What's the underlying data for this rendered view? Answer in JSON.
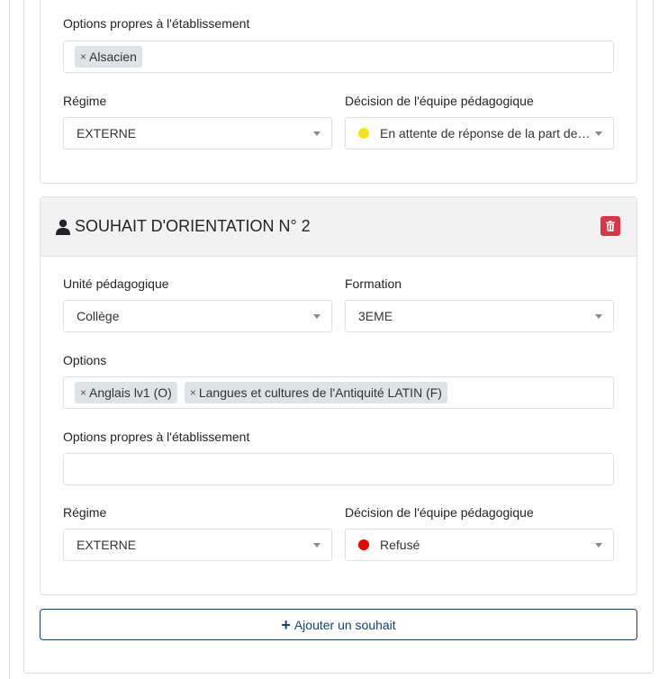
{
  "card1": {
    "options_propres_label": "Options propres à l'établissement",
    "options_propres_tags": [
      "Alsacien"
    ],
    "regime_label": "Régime",
    "regime_value": "EXTERNE",
    "decision_label": "Décision de l'équipe pédagogique",
    "decision_value": "En attente de réponse de la part de l...",
    "decision_color": "#f5e50f"
  },
  "card2": {
    "title": "SOUHAIT D'ORIENTATION N° 2",
    "unite_label": "Unité pédagogique",
    "unite_value": "Collège",
    "formation_label": "Formation",
    "formation_value": "3EME",
    "options_label": "Options",
    "options_tags": [
      "Anglais lv1 (O)",
      "Langues et cultures de l'Antiquité LATIN (F)"
    ],
    "options_propres_label": "Options propres à l'établissement",
    "regime_label": "Régime",
    "regime_value": "EXTERNE",
    "decision_label": "Décision de l'équipe pédagogique",
    "decision_value": "Refusé",
    "decision_color": "#ee0000"
  },
  "add_button_label": "Ajouter un souhait",
  "colors": {
    "danger": "#dc3545",
    "primary_outline": "#17426e",
    "tag_bg": "#dde3e6"
  },
  "tag_remove_glyph": "×"
}
